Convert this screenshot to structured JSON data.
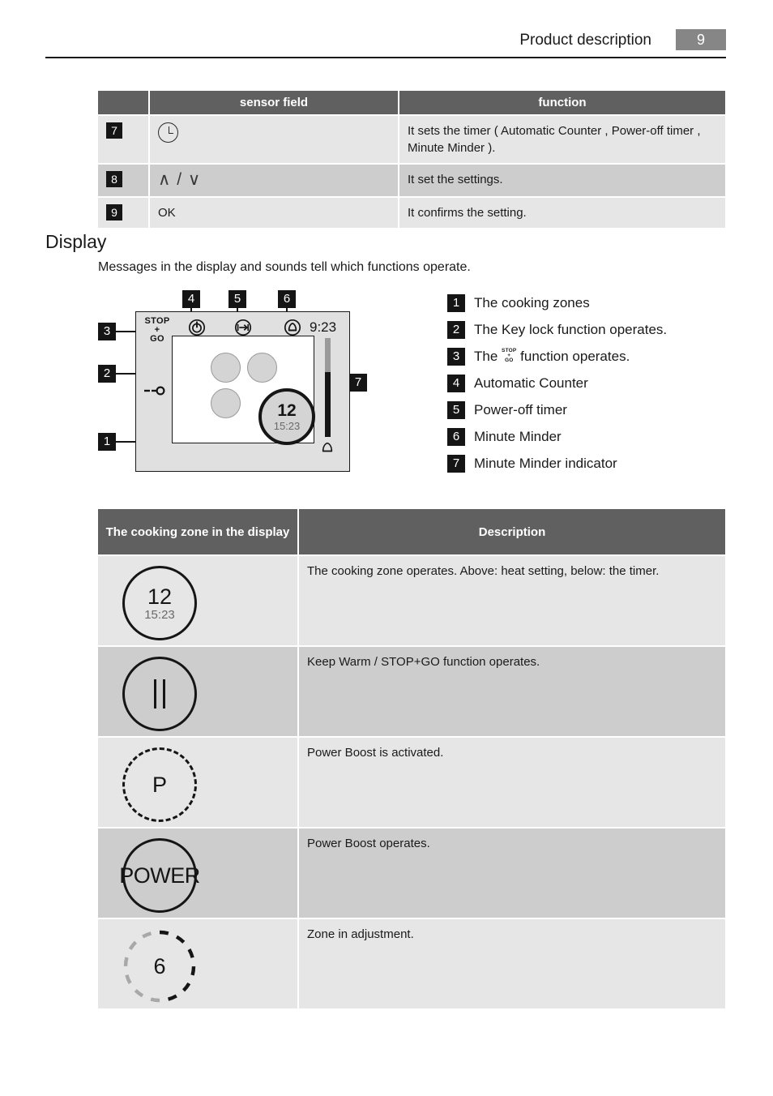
{
  "header": {
    "title": "Product description",
    "page_number": "9"
  },
  "sensor_table": {
    "columns": [
      "",
      "sensor field",
      "function"
    ],
    "rows": [
      {
        "number": "7",
        "sensor_icon": "clock-icon",
        "sensor_label": "",
        "function": "It sets the timer ( Automatic Counter , Power-off timer , Minute Minder )."
      },
      {
        "number": "8",
        "sensor_icon": "chevron-up-down-icon",
        "sensor_label": "∧ / ∨",
        "function": "It set the settings."
      },
      {
        "number": "9",
        "sensor_icon": "",
        "sensor_label": "OK",
        "function": "It confirms the setting."
      }
    ]
  },
  "display_section": {
    "heading": "Display",
    "intro": "Messages in the display and sounds tell which functions operate."
  },
  "figure": {
    "callouts": [
      "1",
      "2",
      "3",
      "4",
      "5",
      "6",
      "7"
    ],
    "stop_go": {
      "line1": "STOP",
      "line2": "+",
      "line3": "GO"
    },
    "clock": "9:23",
    "active_zone": {
      "heat": "12",
      "timer": "15:23"
    },
    "icons": {
      "auto_counter": "stopwatch-icon",
      "power_off_timer": "arrow-to-bar-icon",
      "minute_minder": "bell-icon",
      "key_lock": "key-icon",
      "minute_minder_bell": "bell-outline-icon"
    }
  },
  "legend": {
    "items": [
      {
        "number": "1",
        "text": "The cooking zones"
      },
      {
        "number": "2",
        "text": "The Key lock function operates."
      },
      {
        "number": "3",
        "text_before": "The ",
        "inline_icon": "stop-plus-go-icon",
        "text_after": " function operates."
      },
      {
        "number": "4",
        "text": "Automatic Counter"
      },
      {
        "number": "5",
        "text": "Power-off timer"
      },
      {
        "number": "6",
        "text": "Minute Minder"
      },
      {
        "number": "7",
        "text": "Minute Minder indicator"
      }
    ]
  },
  "zone_table": {
    "columns": [
      "The cooking zone in the display",
      "Description"
    ],
    "rows": [
      {
        "symbol_type": "solid-circle-heat-timer",
        "symbol_heat": "12",
        "symbol_timer": "15:23",
        "description": "The cooking zone operates. Above: heat setting, below: the timer."
      },
      {
        "symbol_type": "solid-circle-pause",
        "symbol_text": "‖",
        "description": "Keep Warm / STOP+GO function operates."
      },
      {
        "symbol_type": "dashed-circle-letter",
        "symbol_text": "P",
        "description": "Power Boost is activated."
      },
      {
        "symbol_type": "solid-circle-word",
        "symbol_text": "POWER",
        "description": "Power Boost operates."
      },
      {
        "symbol_type": "dashed-circle-two-tone",
        "symbol_text": "6",
        "description": "Zone in adjustment."
      }
    ]
  },
  "colors": {
    "table_header_bg": "#606060",
    "row_light": "#e6e6e6",
    "row_dark": "#cdcdcd",
    "badge_bg": "#151515",
    "page_badge_bg": "#868686",
    "panel_bg": "#e0e0e0",
    "zone_fill": "#d4d4d4"
  }
}
